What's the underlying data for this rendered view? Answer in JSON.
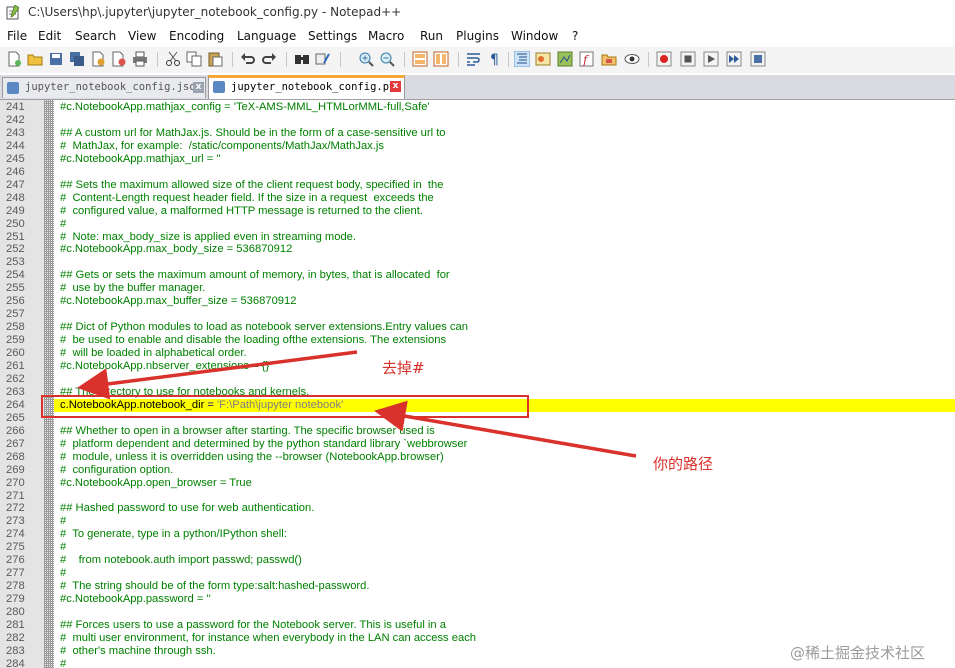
{
  "window": {
    "title": "C:\\Users\\hp\\.jupyter\\jupyter_notebook_config.py - Notepad++"
  },
  "menu": [
    "File",
    "Edit",
    "Search",
    "View",
    "Encoding",
    "Language",
    "Settings",
    "Macro",
    "Run",
    "Plugins",
    "Window",
    "?"
  ],
  "tabs": [
    {
      "label": "jupyter_notebook_config.json",
      "active": false
    },
    {
      "label": "jupyter_notebook_config.py",
      "active": true
    }
  ],
  "close_glyph": "x",
  "lines": [
    {
      "n": "241",
      "text": "#c.NotebookApp.mathjax_config = 'TeX-AMS-MML_HTMLorMML-full,Safe'"
    },
    {
      "n": "242",
      "text": ""
    },
    {
      "n": "243",
      "text": "## A custom url for MathJax.js. Should be in the form of a case-sensitive url to"
    },
    {
      "n": "244",
      "text": "#  MathJax, for example:  /static/components/MathJax/MathJax.js"
    },
    {
      "n": "245",
      "text": "#c.NotebookApp.mathjax_url = ''"
    },
    {
      "n": "246",
      "text": ""
    },
    {
      "n": "247",
      "text": "## Sets the maximum allowed size of the client request body, specified in  the"
    },
    {
      "n": "248",
      "text": "#  Content-Length request header field. If the size in a request  exceeds the"
    },
    {
      "n": "249",
      "text": "#  configured value, a malformed HTTP message is returned to the client."
    },
    {
      "n": "250",
      "text": "#"
    },
    {
      "n": "251",
      "text": "#  Note: max_body_size is applied even in streaming mode."
    },
    {
      "n": "252",
      "text": "#c.NotebookApp.max_body_size = 536870912"
    },
    {
      "n": "253",
      "text": ""
    },
    {
      "n": "254",
      "text": "## Gets or sets the maximum amount of memory, in bytes, that is allocated  for"
    },
    {
      "n": "255",
      "text": "#  use by the buffer manager."
    },
    {
      "n": "256",
      "text": "#c.NotebookApp.max_buffer_size = 536870912"
    },
    {
      "n": "257",
      "text": ""
    },
    {
      "n": "258",
      "text": "## Dict of Python modules to load as notebook server extensions.Entry values can"
    },
    {
      "n": "259",
      "text": "#  be used to enable and disable the loading ofthe extensions. The extensions"
    },
    {
      "n": "260",
      "text": "#  will be loaded in alphabetical order."
    },
    {
      "n": "261",
      "text": "#c.NotebookApp.nbserver_extensions = {}"
    },
    {
      "n": "262",
      "text": ""
    },
    {
      "n": "263",
      "text": "## The directory to use for notebooks and kernels."
    },
    {
      "n": "264",
      "text": "",
      "active": true
    },
    {
      "n": "265",
      "text": ""
    },
    {
      "n": "266",
      "text": "## Whether to open in a browser after starting. The specific browser used is"
    },
    {
      "n": "267",
      "text": "#  platform dependent and determined by the python standard library `webbrowser"
    },
    {
      "n": "268",
      "text": "#  module, unless it is overridden using the --browser (NotebookApp.browser)"
    },
    {
      "n": "269",
      "text": "#  configuration option."
    },
    {
      "n": "270",
      "text": "#c.NotebookApp.open_browser = True"
    },
    {
      "n": "271",
      "text": ""
    },
    {
      "n": "272",
      "text": "## Hashed password to use for web authentication."
    },
    {
      "n": "273",
      "text": "#"
    },
    {
      "n": "274",
      "text": "#  To generate, type in a python/IPython shell:"
    },
    {
      "n": "275",
      "text": "#"
    },
    {
      "n": "276",
      "text": "#    from notebook.auth import passwd; passwd()"
    },
    {
      "n": "277",
      "text": "#"
    },
    {
      "n": "278",
      "text": "#  The string should be of the form type:salt:hashed-password."
    },
    {
      "n": "279",
      "text": "#c.NotebookApp.password = ''"
    },
    {
      "n": "280",
      "text": ""
    },
    {
      "n": "281",
      "text": "## Forces users to use a password for the Notebook server. This is useful in a"
    },
    {
      "n": "282",
      "text": "#  multi user environment, for instance when everybody in the LAN can access each"
    },
    {
      "n": "283",
      "text": "#  other's machine through ssh."
    },
    {
      "n": "284",
      "text": "#"
    }
  ],
  "active_line": {
    "var": "c.NotebookApp.notebook_dir",
    "op": " = ",
    "str": "'F:\\Path\\jupyter notebook'"
  },
  "annotations": {
    "remove_hash": "去掉#",
    "your_path": "你的路径"
  },
  "watermark": "@稀土掘金技术社区",
  "colors": {
    "comment": "#008000",
    "current_line": "#ffff00",
    "annotation_red": "#d9312b",
    "active_tab_accent": "#f6a833",
    "string": "#808080"
  }
}
